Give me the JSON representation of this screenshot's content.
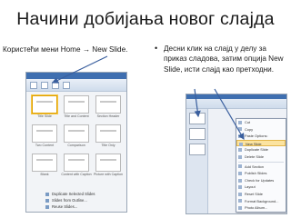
{
  "slide": {
    "title": "Начини добијања новог слајда",
    "left_caption": "Користећи мени Home → New Slide.",
    "bullet": "•",
    "right_text": "Десни клик на слајд у делу за приказ сладова, затим опција New Slide, исти слајд као претходни."
  },
  "left_screenshot": {
    "layouts": [
      {
        "caption": "Title Slide"
      },
      {
        "caption": "Title and Content"
      },
      {
        "caption": "Section Header"
      },
      {
        "caption": "Two Content"
      },
      {
        "caption": "Comparison"
      },
      {
        "caption": "Title Only"
      },
      {
        "caption": "Blank"
      },
      {
        "caption": "Content with Caption"
      },
      {
        "caption": "Picture with Caption"
      }
    ],
    "menu": [
      "Duplicate Selected Slides",
      "Slides from Outline...",
      "Reuse Slides..."
    ]
  },
  "right_screenshot": {
    "context_menu": [
      "Cut",
      "Copy",
      "Paste Options:",
      "New Slide",
      "Duplicate Slide",
      "Delete Slide",
      "Add Section",
      "Publish Slides",
      "Check for Updates",
      "Layout",
      "Reset Slide",
      "Format Background...",
      "Photo Album...",
      "Hide Slide"
    ],
    "highlighted_item": "New Slide"
  },
  "colors": {
    "ribbon_blue": "#3f6fb0",
    "highlight": "#fbe3a0",
    "arrow": "#3a5f9e"
  }
}
